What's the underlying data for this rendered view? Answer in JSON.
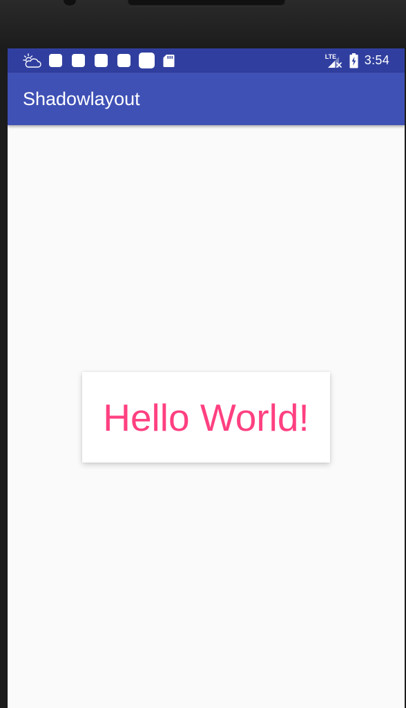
{
  "app": {
    "title": "Shadowlayout"
  },
  "status_bar": {
    "time": "3:54",
    "network_label": "LTE",
    "left_icons": [
      "weather-cloud-icon",
      "notification-icon",
      "notification-icon",
      "notification-icon",
      "notification-icon",
      "notification-icon",
      "sd-card-icon"
    ],
    "right_icons": [
      "signal-lte-icon",
      "battery-charging-icon"
    ]
  },
  "content": {
    "hello_text": "Hello World!"
  },
  "colors": {
    "status_bar": "#303f9f",
    "app_bar": "#3f51b5",
    "accent": "#ff4081",
    "background": "#fafafa"
  }
}
